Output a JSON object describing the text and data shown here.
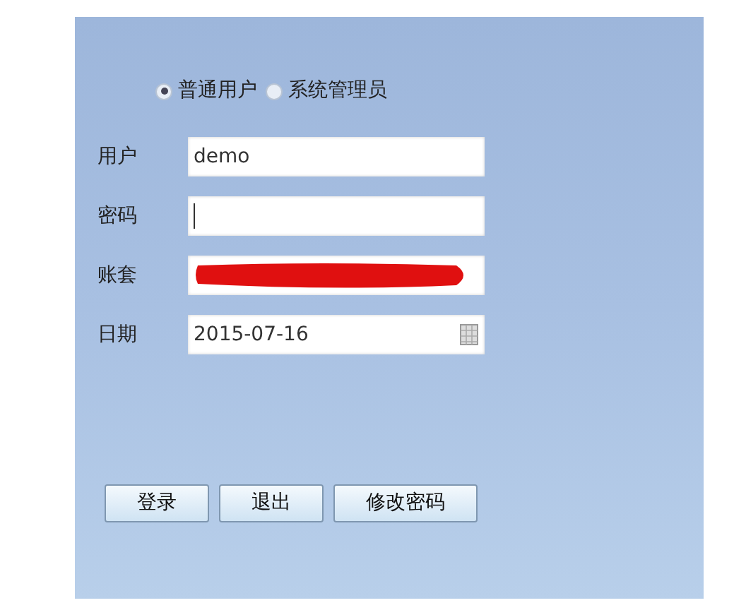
{
  "user_type": [
    {
      "label": "普通用户",
      "selected": true
    },
    {
      "label": "系统管理员",
      "selected": false
    }
  ],
  "fields": [
    {
      "label": "用户",
      "kind": "text",
      "value": "demo"
    },
    {
      "label": "密码",
      "kind": "password"
    },
    {
      "label": "账套",
      "kind": "redacted"
    },
    {
      "label": "日期",
      "kind": "date",
      "value": "2015-07-16"
    }
  ],
  "buttons": [
    "登录",
    "退出",
    "修改密码"
  ]
}
